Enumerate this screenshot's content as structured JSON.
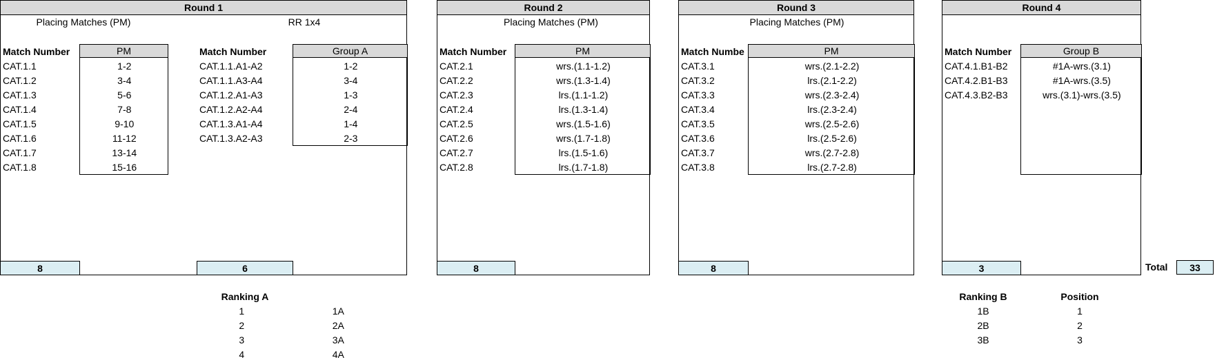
{
  "round1": {
    "title": "Round 1",
    "subtitle_left": "Placing Matches (PM)",
    "subtitle_right": "RR 1x4",
    "match_number_label": "Match Number",
    "pm_header": "PM",
    "pm_matches": [
      {
        "number": "CAT.1.1",
        "pm": "1-2"
      },
      {
        "number": "CAT.1.2",
        "pm": "3-4"
      },
      {
        "number": "CAT.1.3",
        "pm": "5-6"
      },
      {
        "number": "CAT.1.4",
        "pm": "7-8"
      },
      {
        "number": "CAT.1.5",
        "pm": "9-10"
      },
      {
        "number": "CAT.1.6",
        "pm": "11-12"
      },
      {
        "number": "CAT.1.7",
        "pm": "13-14"
      },
      {
        "number": "CAT.1.8",
        "pm": "15-16"
      }
    ],
    "group_header": "Group A",
    "group_matches": [
      {
        "number": "CAT.1.1.A1-A2",
        "pm": "1-2"
      },
      {
        "number": "CAT.1.1.A3-A4",
        "pm": "3-4"
      },
      {
        "number": "CAT.1.2.A1-A3",
        "pm": "1-3"
      },
      {
        "number": "CAT.1.2.A2-A4",
        "pm": "2-4"
      },
      {
        "number": "CAT.1.3.A1-A4",
        "pm": "1-4"
      },
      {
        "number": "CAT.1.3.A2-A3",
        "pm": "2-3"
      }
    ],
    "count_pm": "8",
    "count_group": "6"
  },
  "round2": {
    "title": "Round 2",
    "subtitle": "Placing Matches (PM)",
    "match_number_label": "Match Number",
    "pm_header": "PM",
    "matches": [
      {
        "number": "CAT.2.1",
        "pm": "wrs.(1.1-1.2)"
      },
      {
        "number": "CAT.2.2",
        "pm": "wrs.(1.3-1.4)"
      },
      {
        "number": "CAT.2.3",
        "pm": "lrs.(1.1-1.2)"
      },
      {
        "number": "CAT.2.4",
        "pm": "lrs.(1.3-1.4)"
      },
      {
        "number": "CAT.2.5",
        "pm": "wrs.(1.5-1.6)"
      },
      {
        "number": "CAT.2.6",
        "pm": "wrs.(1.7-1.8)"
      },
      {
        "number": "CAT.2.7",
        "pm": "lrs.(1.5-1.6)"
      },
      {
        "number": "CAT.2.8",
        "pm": "lrs.(1.7-1.8)"
      }
    ],
    "count": "8"
  },
  "round3": {
    "title": "Round 3",
    "subtitle": "Placing Matches (PM)",
    "match_number_label": "Match Numbe",
    "pm_header": "PM",
    "matches": [
      {
        "number": "CAT.3.1",
        "pm": "wrs.(2.1-2.2)"
      },
      {
        "number": "CAT.3.2",
        "pm": "lrs.(2.1-2.2)"
      },
      {
        "number": "CAT.3.3",
        "pm": "wrs.(2.3-2.4)"
      },
      {
        "number": "CAT.3.4",
        "pm": "lrs.(2.3-2.4)"
      },
      {
        "number": "CAT.3.5",
        "pm": "wrs.(2.5-2.6)"
      },
      {
        "number": "CAT.3.6",
        "pm": "lrs.(2.5-2.6)"
      },
      {
        "number": "CAT.3.7",
        "pm": "wrs.(2.7-2.8)"
      },
      {
        "number": "CAT.3.8",
        "pm": "lrs.(2.7-2.8)"
      }
    ],
    "count": "8"
  },
  "round4": {
    "title": "Round 4",
    "match_number_label": "Match Number",
    "group_header": "Group B",
    "matches": [
      {
        "number": "CAT.4.1.B1-B2",
        "pm": "#1A-wrs.(3.1)"
      },
      {
        "number": "CAT.4.2.B1-B3",
        "pm": "#1A-wrs.(3.5)"
      },
      {
        "number": "CAT.4.3.B2-B3",
        "pm": "wrs.(3.1)-wrs.(3.5)"
      }
    ],
    "count": "3"
  },
  "total": {
    "label": "Total",
    "value": "33"
  },
  "ranking_a": {
    "title": "Ranking A",
    "rows": [
      {
        "rank": "1",
        "code": "1A"
      },
      {
        "rank": "2",
        "code": "2A"
      },
      {
        "rank": "3",
        "code": "3A"
      },
      {
        "rank": "4",
        "code": "4A"
      }
    ]
  },
  "ranking_b": {
    "title": "Ranking B",
    "position_header": "Position",
    "rows": [
      {
        "code": "1B",
        "position": "1"
      },
      {
        "code": "2B",
        "position": "2"
      },
      {
        "code": "3B",
        "position": "3"
      }
    ]
  },
  "colors": {
    "header_gray": "#d9d9d9",
    "count_blue": "#dbeef3",
    "border": "#000000"
  }
}
